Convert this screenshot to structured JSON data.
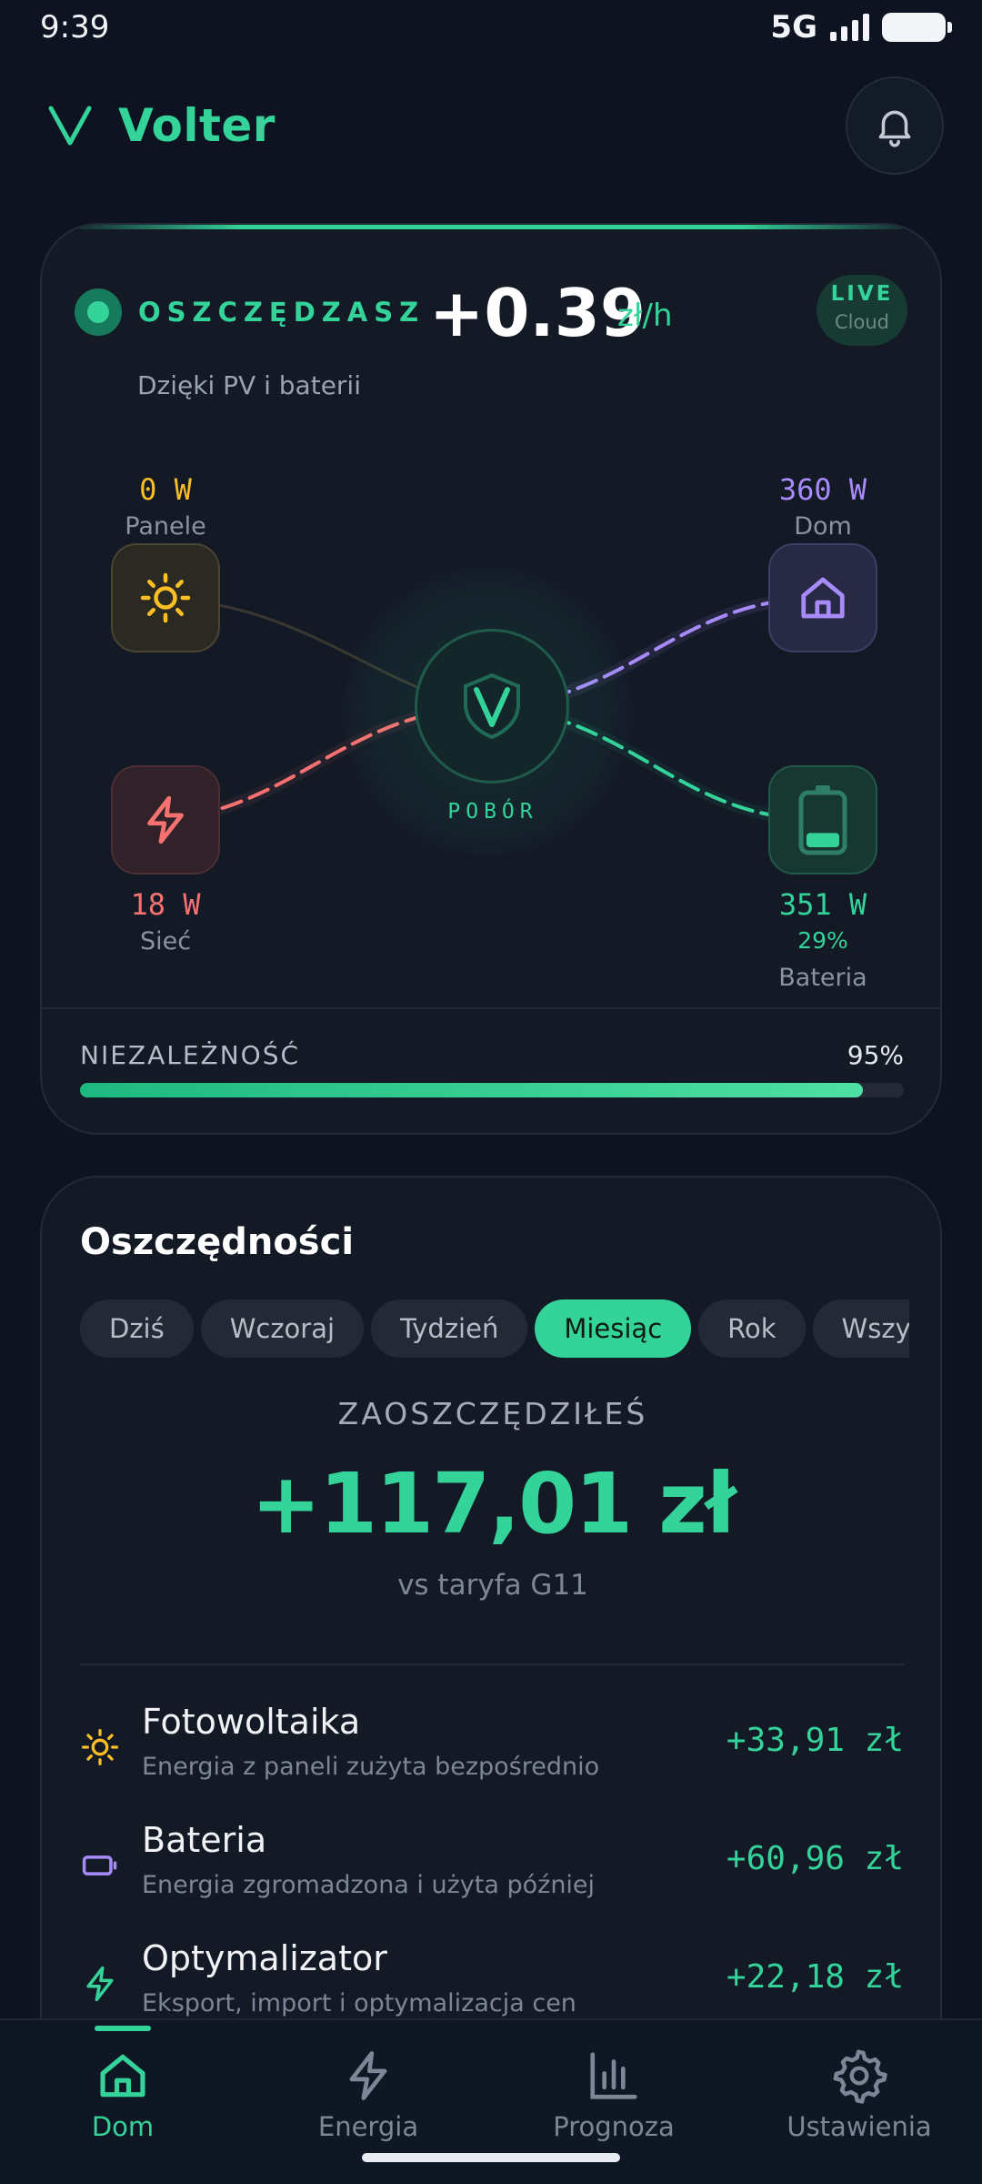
{
  "status_bar": {
    "time": "9:39",
    "network": "5G"
  },
  "header": {
    "app_name": "Volter",
    "logo_icon": "volter-v-logo-icon",
    "notification_icon": "bell-icon"
  },
  "flow_card": {
    "savings_label": "OSZCZĘDZASZ",
    "savings_value": "+0.39",
    "savings_unit": "zł/h",
    "live_badge": "LIVE",
    "live_sub": "Cloud",
    "savings_subtitle": "Dzięki PV i baterii",
    "nodes": {
      "panels": {
        "value": "0 W",
        "label": "Panele",
        "icon": "sun-icon",
        "color": "#fbbf24"
      },
      "home": {
        "value": "360 W",
        "label": "Dom",
        "icon": "house-icon",
        "color": "#a78bfa"
      },
      "grid": {
        "value": "18 W",
        "label": "Sieć",
        "icon": "lightning-icon",
        "color": "#f87171"
      },
      "battery": {
        "value": "351 W",
        "percent": "29%",
        "label": "Bateria",
        "icon": "battery-icon",
        "color": "#34d399",
        "level": 0.29
      }
    },
    "hub_label": "POBÓR",
    "hub_icon": "volter-shield-icon",
    "independence_label": "NIEZALEŻNOŚĆ",
    "independence_value": "95%",
    "independence_fraction": 0.95
  },
  "savings_card": {
    "title": "Oszczędności",
    "tabs": [
      {
        "label": "Dziś",
        "active": false
      },
      {
        "label": "Wczoraj",
        "active": false
      },
      {
        "label": "Tydzień",
        "active": false
      },
      {
        "label": "Miesiąc",
        "active": true
      },
      {
        "label": "Rok",
        "active": false
      },
      {
        "label": "Wszystko",
        "active": false
      }
    ],
    "total_label": "ZAOSZCZĘDZIŁEŚ",
    "total_value": "+117,01 zł",
    "total_sub": "vs taryfa G11",
    "items": [
      {
        "title": "Fotowoltaika",
        "desc": "Energia z paneli zużyta bezpośrednio",
        "value": "+33,91 zł",
        "icon": "sun-icon",
        "color": "#fbbf24"
      },
      {
        "title": "Bateria",
        "desc": "Energia zgromadzona i użyta później",
        "value": "+60,96 zł",
        "icon": "battery-icon",
        "color": "#a78bfa"
      },
      {
        "title": "Optymalizator",
        "desc": "Eksport, import i optymalizacja cen",
        "value": "+22,18 zł",
        "icon": "lightning-icon",
        "color": "#34d399"
      }
    ]
  },
  "bottom_nav": [
    {
      "label": "Dom",
      "icon": "home-icon",
      "active": true
    },
    {
      "label": "Energia",
      "icon": "lightning-icon",
      "active": false
    },
    {
      "label": "Prognoza",
      "icon": "bar-chart-icon",
      "active": false
    },
    {
      "label": "Ustawienia",
      "icon": "gear-icon",
      "active": false
    }
  ],
  "colors": {
    "accent": "#34d399",
    "background": "#0d1320",
    "card": "#131a26"
  }
}
